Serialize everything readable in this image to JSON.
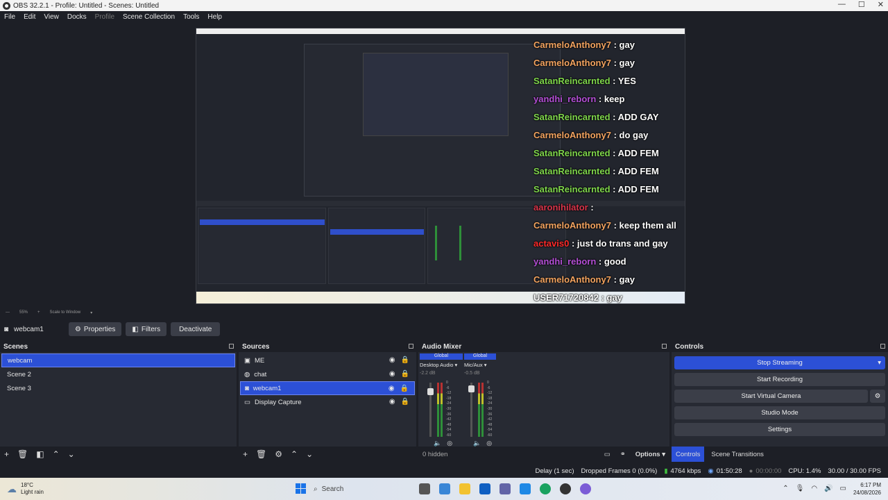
{
  "window": {
    "title": "OBS 32.2.1 - Profile: Untitled - Scenes: Untitled",
    "min": "—",
    "max": "☐",
    "close": "✕"
  },
  "menu": [
    "File",
    "Edit",
    "View",
    "Docks",
    "Profile",
    "Scene Collection",
    "Tools",
    "Help"
  ],
  "chat": [
    {
      "user": "CarmeloAnthony7",
      "color": "#f4a460",
      "msg": " : gay"
    },
    {
      "user": "CarmeloAnthony7",
      "color": "#f4a460",
      "msg": " : gay"
    },
    {
      "user": "SatanReincarnted",
      "color": "#7fd64b",
      "msg": " : YES"
    },
    {
      "user": "yandhi_reborn",
      "color": "#b44fd6",
      "msg": " : keep"
    },
    {
      "user": "SatanReincarnted",
      "color": "#7fd64b",
      "msg": " : ADD GAY"
    },
    {
      "user": "CarmeloAnthony7",
      "color": "#f4a460",
      "msg": " : do gay"
    },
    {
      "user": "SatanReincarnted",
      "color": "#7fd64b",
      "msg": " : ADD FEM"
    },
    {
      "user": "SatanReincarnted",
      "color": "#7fd64b",
      "msg": " : ADD FEM"
    },
    {
      "user": "SatanReincarnted",
      "color": "#7fd64b",
      "msg": " : ADD FEM"
    },
    {
      "user": "aaronihilator",
      "color": "#d9344a",
      "msg": " : "
    },
    {
      "user": "CarmeloAnthony7",
      "color": "#f4a460",
      "msg": " : keep them all"
    },
    {
      "user": "actavis0",
      "color": "#ff2a2a",
      "msg": " : just do trans and gay"
    },
    {
      "user": "yandhi_reborn",
      "color": "#b44fd6",
      "msg": " : good"
    },
    {
      "user": "CarmeloAnthony7",
      "color": "#f4a460",
      "msg": " : gay"
    },
    {
      "user": "USER71720842",
      "color": "#ffffff",
      "msg": " : gay"
    }
  ],
  "source_bar": {
    "current": "webcam1",
    "properties": "Properties",
    "filters": "Filters",
    "deactivate": "Deactivate"
  },
  "scenes": {
    "title": "Scenes",
    "items": [
      "webcam",
      "Scene 2",
      "Scene 3"
    ],
    "selected": 0
  },
  "sources": {
    "title": "Sources",
    "items": [
      "ME",
      "chat",
      "webcam1",
      "Display Capture"
    ],
    "selected": 2
  },
  "mixer": {
    "title": "Audio Mixer",
    "channels": [
      {
        "tag": "Global",
        "name": "Desktop Audio",
        "db": "-2.2 dB",
        "level": 0.62
      },
      {
        "tag": "Global",
        "name": "Mic/Aux",
        "db": "-0.5 dB",
        "level": 0.58
      }
    ],
    "scale": [
      "0",
      "-6",
      "-12",
      "-18",
      "-24",
      "-30",
      "-36",
      "-42",
      "-48",
      "-54",
      "-60"
    ],
    "hidden": "0 hidden"
  },
  "controls": {
    "title": "Controls",
    "buttons": [
      "Stop Streaming",
      "Start Recording",
      "Start Virtual Camera",
      "Studio Mode",
      "Settings"
    ]
  },
  "footer_tabs": {
    "options": "Options",
    "controls": "Controls",
    "transitions": "Scene Transitions"
  },
  "status": {
    "delay": "Delay (1 sec)",
    "dropped": "Dropped Frames 0 (0.0%)",
    "kbps": "4764 kbps",
    "live": "01:50:28",
    "rec": "00:00:00",
    "cpu": "CPU: 1.4%",
    "fps": "30.00 / 30.00 FPS"
  },
  "taskbar": {
    "temp": "18°C",
    "weather": "Light rain",
    "search": "Search",
    "time": "6:17 PM",
    "date": "24/08/2026"
  }
}
